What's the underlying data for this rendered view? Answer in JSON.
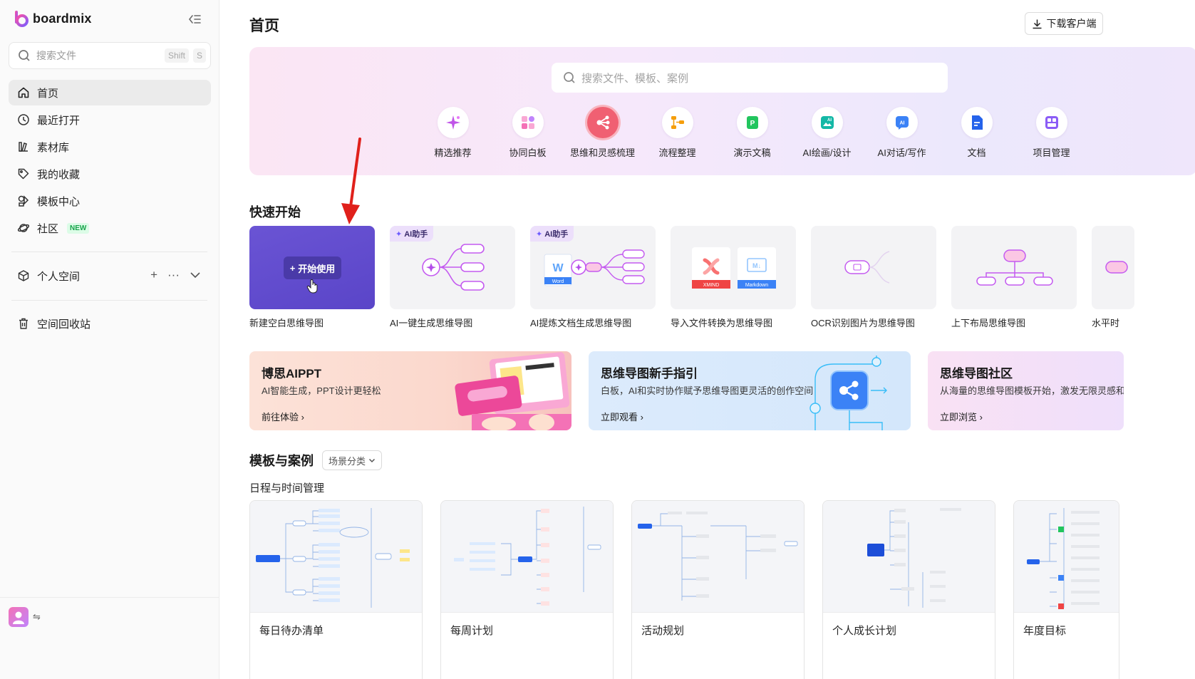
{
  "app": {
    "brand": "boardmix"
  },
  "sidebar": {
    "search_placeholder": "搜索文件",
    "shortcut_keys": [
      "Shift",
      "S"
    ],
    "nav": [
      {
        "label": "首页",
        "icon": "home-icon",
        "active": true
      },
      {
        "label": "最近打开",
        "icon": "clock-icon"
      },
      {
        "label": "素材库",
        "icon": "material-library-icon"
      },
      {
        "label": "我的收藏",
        "icon": "tag-icon"
      },
      {
        "label": "模板中心",
        "icon": "template-icon"
      },
      {
        "label": "社区",
        "icon": "planet-icon",
        "badge": "NEW"
      }
    ],
    "personal_space": "个人空间",
    "trash": "空间回收站"
  },
  "header": {
    "title": "首页",
    "download_label": "下载客户端"
  },
  "hero": {
    "search_placeholder": "搜索文件、模板、案例",
    "categories": [
      {
        "label": "精选推荐",
        "icon": "sparkle-icon",
        "color": "#c055e8"
      },
      {
        "label": "协同白板",
        "icon": "whiteboard-icon",
        "color": "#f472b6"
      },
      {
        "label": "思维和灵感梳理",
        "icon": "mindmap-icon",
        "color": "#ffffff",
        "active": true
      },
      {
        "label": "流程整理",
        "icon": "flowchart-icon",
        "color": "#f59e0b"
      },
      {
        "label": "演示文稿",
        "icon": "presentation-icon",
        "color": "#22c55e"
      },
      {
        "label": "AI绘画/设计",
        "icon": "ai-drawing-icon",
        "color": "#14b8a6"
      },
      {
        "label": "AI对话/写作",
        "icon": "ai-chat-icon",
        "color": "#3b82f6"
      },
      {
        "label": "文档",
        "icon": "document-icon",
        "color": "#2563eb"
      },
      {
        "label": "项目管理",
        "icon": "project-icon",
        "color": "#8b5cf6"
      }
    ]
  },
  "quick_start": {
    "title": "快速开始",
    "start_label": "开始使用",
    "ai_tag": "AI助手",
    "import_badges": [
      "XMIND",
      "Markdown"
    ],
    "word_badge": "Word",
    "cards": [
      "新建空白思维导图",
      "AI一键生成思维导图",
      "AI提炼文档生成思维导图",
      "导入文件转换为思维导图",
      "OCR识别图片为思维导图",
      "上下布局思维导图",
      "水平时"
    ]
  },
  "banners": [
    {
      "title": "博思AIPPT",
      "subtitle": "AI智能生成，PPT设计更轻松",
      "link": "前往体验"
    },
    {
      "title": "思维导图新手指引",
      "subtitle": "白板，AI和实时协作赋予思维导图更灵活的创作空间",
      "link": "立即观看"
    },
    {
      "title": "思维导图社区",
      "subtitle": "从海量的思维导图模板开始，激发无限灵感和",
      "link": "立即浏览"
    }
  ],
  "templates": {
    "title": "模板与案例",
    "filter_label": "场景分类",
    "subsection": "日程与时间管理",
    "items": [
      "每日待办清单",
      "每周计划",
      "活动规划",
      "个人成长计划",
      "年度目标"
    ]
  }
}
